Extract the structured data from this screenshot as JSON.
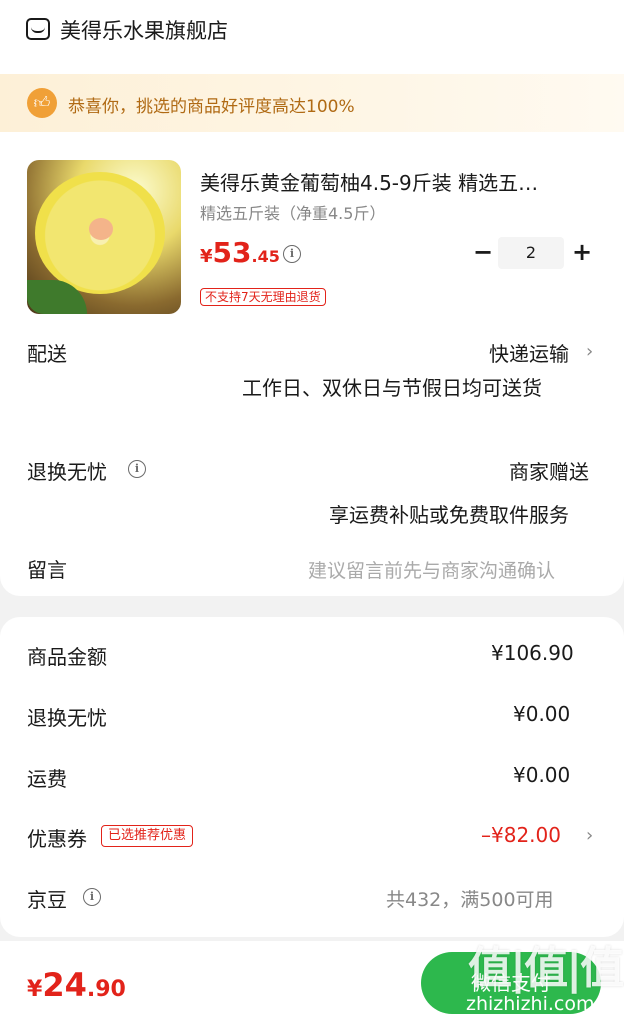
{
  "store": {
    "name": "美得乐水果旗舰店",
    "icon": "store-icon"
  },
  "praise": {
    "text": "恭喜你，挑选的商品好评度高达100%",
    "icon": "thumbs-up-icon",
    "bg": "#fdf0d7",
    "accent": "#f0a037"
  },
  "product": {
    "title": "美得乐黄金葡萄柚4.5-9斤装 精选五…",
    "spec": "精选五斤装（净重4.5斤）",
    "price_symbol": "¥",
    "price_int": "53",
    "price_dec": ".45",
    "return_tag": "不支持7天无理由退货",
    "qty": "2",
    "minus": "−",
    "plus": "+"
  },
  "delivery": {
    "label": "配送",
    "method": "快递运输",
    "note": "工作日、双休日与节假日均可送货"
  },
  "worry_free": {
    "label": "退换无忧",
    "value": "商家赠送",
    "note": "享运费补贴或免费取件服务"
  },
  "message": {
    "label": "留言",
    "placeholder": "建议留言前先与商家沟通确认"
  },
  "fees": {
    "goods_amount": {
      "label": "商品金额",
      "value": "¥106.90"
    },
    "worry_free": {
      "label": "退换无忧",
      "value": "¥0.00"
    },
    "shipping": {
      "label": "运费",
      "value": "¥0.00"
    },
    "coupon": {
      "label": "优惠券",
      "tag": "已选推荐优惠",
      "value": "–¥82.00"
    },
    "jingdou": {
      "label": "京豆",
      "value": "共432，满500可用"
    }
  },
  "bottom": {
    "total_symbol": "¥",
    "total_int": "24",
    "total_dec": ".90",
    "pay_label": "微信支付",
    "watermark_text": "值|值|值",
    "watermark_url": "zhizhizhi.com"
  },
  "colors": {
    "price_red": "#e2231a",
    "pay_green": "#2db84d"
  }
}
